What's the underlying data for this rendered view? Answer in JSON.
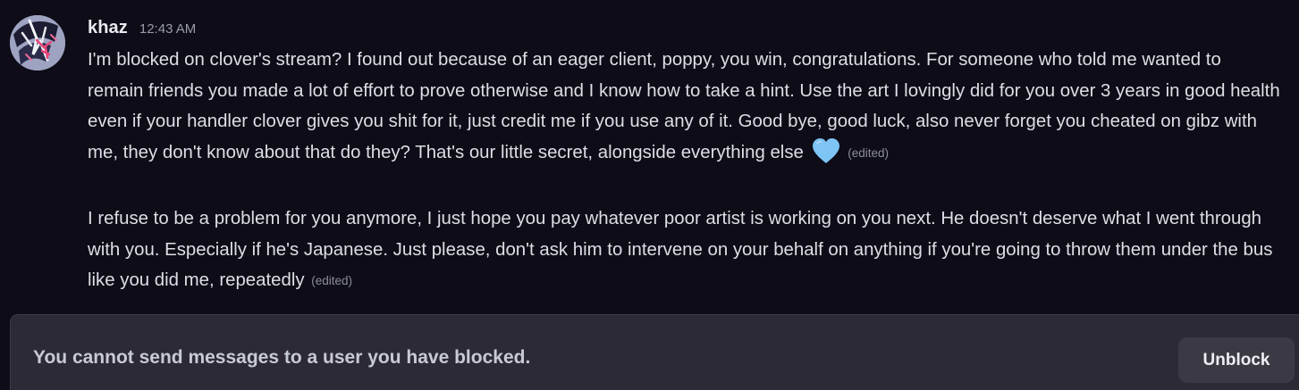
{
  "message_group": {
    "author": "khaz",
    "timestamp": "12:43 AM",
    "messages": [
      {
        "text": "I'm blocked on clover's stream? I found out because of an eager client, poppy, you win, congratulations. For someone who told me wanted to remain friends you made a lot of effort to prove otherwise and I know how to take a hint. Use the art I lovingly did for you over 3 years in good health even if your handler clover gives you shit for it, just credit me if you use any of it. Good bye, good luck, also never forget you cheated on gibz with me, they don't know about that do they? That's our little secret, alongside everything else",
        "emoji": "blue-heart-icon",
        "edited_label": "(edited)"
      },
      {
        "text": "I refuse to be a problem for you anymore, I just hope you pay whatever poor artist is working on you next. He doesn't deserve what I went through with you. Especially if he's Japanese. Just please, don't ask him to intervene on your behalf on anything if you're going to throw them under the bus like you did me, repeatedly",
        "edited_label": "(edited)"
      }
    ]
  },
  "blocked_bar": {
    "text": "You cannot send messages to a user you have blocked.",
    "unblock_label": "Unblock"
  },
  "colors": {
    "background": "#0d0c17",
    "text": "#dddfe6",
    "muted": "#9a9cab",
    "heart": "#7ec4f4",
    "bar": "#2b2a35",
    "button": "#3a3944"
  }
}
